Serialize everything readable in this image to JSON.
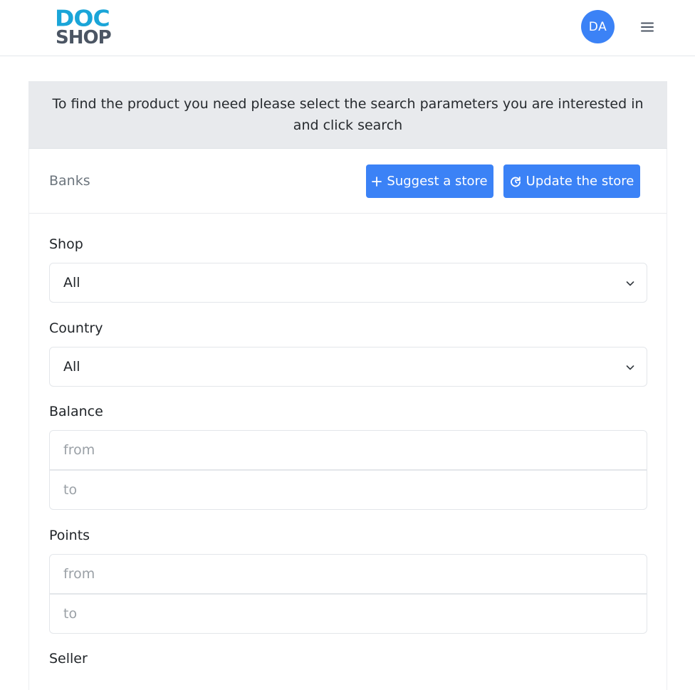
{
  "header": {
    "logo_line1": "DOC",
    "logo_line2": "SHOP",
    "avatar_initials": "DA",
    "menu_icon": "hamburger-icon"
  },
  "banner": {
    "text": "To find the product you need please select the search parameters you are interested in and click search"
  },
  "card": {
    "title": "Banks",
    "suggest_button": "Suggest a store",
    "suggest_icon": "plus-icon",
    "update_button": "Update the store",
    "update_icon": "refresh-icon"
  },
  "filters": {
    "shop": {
      "label": "Shop",
      "value": "All"
    },
    "country": {
      "label": "Country",
      "value": "All"
    },
    "balance": {
      "label": "Balance",
      "from_placeholder": "from",
      "to_placeholder": "to"
    },
    "points": {
      "label": "Points",
      "from_placeholder": "from",
      "to_placeholder": "to"
    },
    "seller": {
      "label": "Seller"
    }
  },
  "colors": {
    "primary": "#3b82f6",
    "logo_accent": "#1aa5d8",
    "banner_bg": "#e8eaed"
  }
}
